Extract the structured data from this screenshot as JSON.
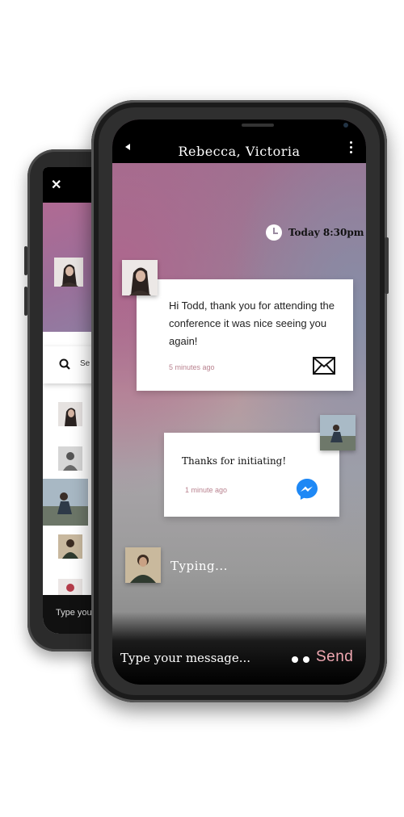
{
  "back_screen": {
    "close_icon": "close-icon",
    "search_placeholder": "Se",
    "input_placeholder": "Type your"
  },
  "chat": {
    "title": "Rebecca, Victoria",
    "timestamp": "Today 8:30pm",
    "messages": [
      {
        "text": "Hi Todd, thank you for attending the conference it was nice seeing you again!",
        "time": "5 minutes ago",
        "icon": "envelope-icon"
      },
      {
        "text": "Thanks for initiating!",
        "time": "1 minute ago",
        "icon": "messenger-icon"
      }
    ],
    "typing": "Typing...",
    "input_placeholder": "Type your message...",
    "send_label": "Send"
  },
  "colors": {
    "send": "#f0a8b2",
    "time_muted": "#b9828f",
    "messenger_blue": "#1e88f5"
  }
}
